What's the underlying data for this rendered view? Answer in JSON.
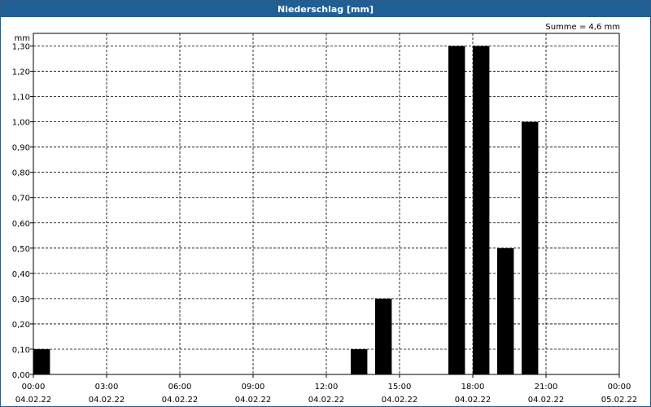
{
  "window": {
    "title": "Niederschlag [mm]"
  },
  "summary": {
    "text": "Summe = 4,6 mm"
  },
  "chart_data": {
    "type": "bar",
    "title": "Niederschlag [mm]",
    "ylabel": "mm",
    "xlabel": "",
    "ylim": [
      0,
      1.35
    ],
    "grid": true,
    "y_ticks": [
      "0,00",
      "0,10",
      "0,20",
      "0,30",
      "0,40",
      "0,50",
      "0,60",
      "0,70",
      "0,80",
      "0,90",
      "1,00",
      "1,10",
      "1,20",
      "1,30"
    ],
    "x_ticks": [
      {
        "time": "00:00",
        "date": "04.02.22"
      },
      {
        "time": "03:00",
        "date": "04.02.22"
      },
      {
        "time": "06:00",
        "date": "04.02.22"
      },
      {
        "time": "09:00",
        "date": "04.02.22"
      },
      {
        "time": "12:00",
        "date": "04.02.22"
      },
      {
        "time": "15:00",
        "date": "04.02.22"
      },
      {
        "time": "18:00",
        "date": "04.02.22"
      },
      {
        "time": "21:00",
        "date": "04.02.22"
      },
      {
        "time": "00:00",
        "date": "05.02.22"
      }
    ],
    "bars": [
      {
        "time": "04.02.22 00:00",
        "value": 0.1
      },
      {
        "time": "04.02.22 13:00",
        "value": 0.1
      },
      {
        "time": "04.02.22 14:00",
        "value": 0.3
      },
      {
        "time": "04.02.22 17:00",
        "value": 1.3
      },
      {
        "time": "04.02.22 18:00",
        "value": 1.3
      },
      {
        "time": "04.02.22 19:00",
        "value": 0.5
      },
      {
        "time": "04.02.22 20:00",
        "value": 1.0
      }
    ],
    "bar_color": "#000000"
  }
}
